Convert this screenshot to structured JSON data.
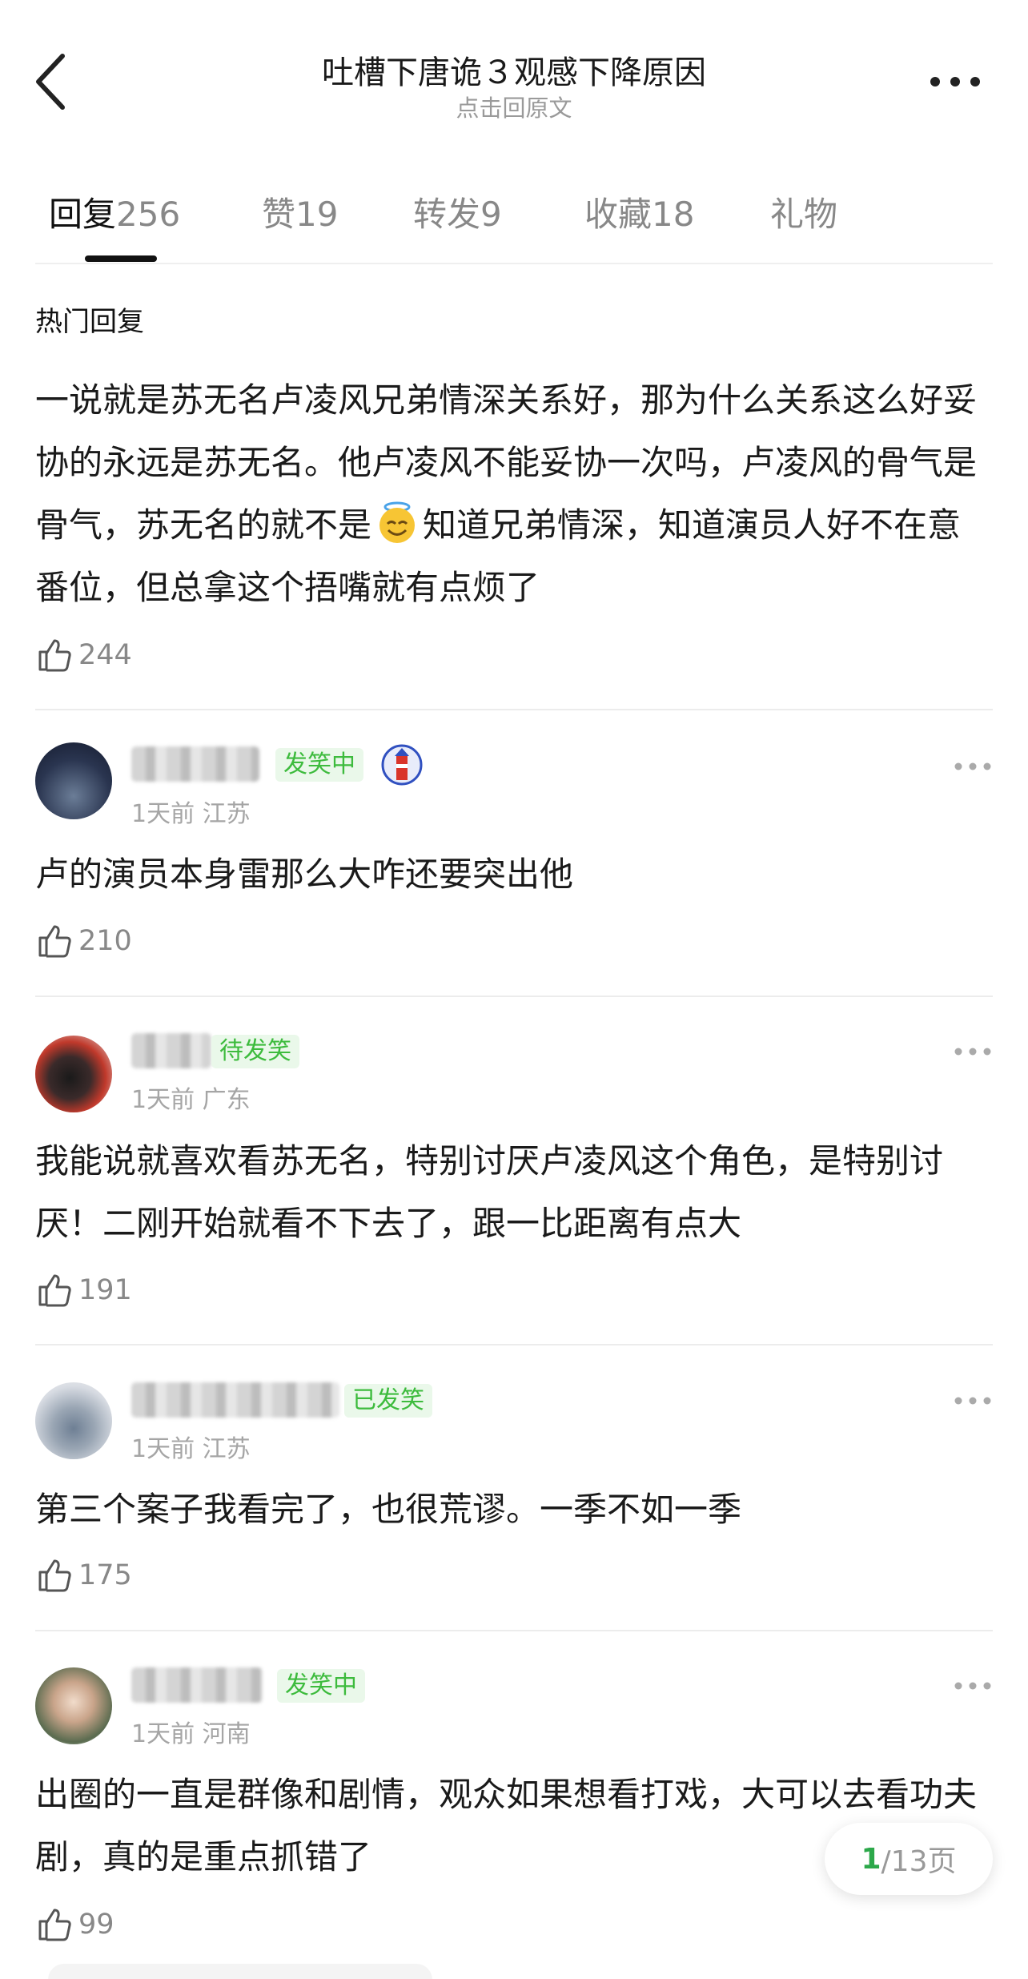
{
  "header": {
    "title": "吐槽下唐诡３观感下降原因",
    "subtitle": "点击回原文"
  },
  "tabs": [
    {
      "label": "回复",
      "count": "256",
      "active": true
    },
    {
      "label": "赞",
      "count": "19"
    },
    {
      "label": "转发",
      "count": "9"
    },
    {
      "label": "收藏",
      "count": "18"
    },
    {
      "label": "礼物",
      "count": ""
    }
  ],
  "section_title": "热门回复",
  "top_post": {
    "text_part1": "一说就是苏无名卢凌风兄弟情深关系好，那为什么关系这么好妥协的永远是苏无名。他卢凌风不能妥协一次吗，卢凌风的骨气是骨气，苏无名的就不是",
    "emoji": "smiling-face-with-halo",
    "text_part2": "知道兄弟情深，知道演员人好不在意番位，但总拿这个捂嘴就有点烦了",
    "likes": "244"
  },
  "comments": [
    {
      "badge": "发笑中",
      "meta": "1天前 江苏",
      "text": "卢的演员本身雷那么大咋还要突出他",
      "likes": "210",
      "has_lighthouse_icon": true
    },
    {
      "badge": "待发笑",
      "meta": "1天前 广东",
      "text": "我能说就喜欢看苏无名，特别讨厌卢凌风这个角色，是特别讨厌！二刚开始就看不下去了，跟一比距离有点大",
      "likes": "191"
    },
    {
      "badge": "已发笑",
      "meta": "1天前 江苏",
      "text": "第三个案子我看完了，也很荒谬。一季不如一季",
      "likes": "175"
    },
    {
      "badge": "发笑中",
      "meta": "1天前 河南",
      "text": "出圈的一直是群像和剧情，观众如果想看打戏，大可以去看功夫剧，真的是重点抓错了",
      "likes": "99"
    }
  ],
  "pager": {
    "current": "1",
    "rest": "/13页"
  },
  "colors": {
    "accent_green": "#3dbb3d",
    "pager_green": "#2ca84a",
    "text": "#1a1a1a",
    "muted": "#9a9a9a"
  }
}
